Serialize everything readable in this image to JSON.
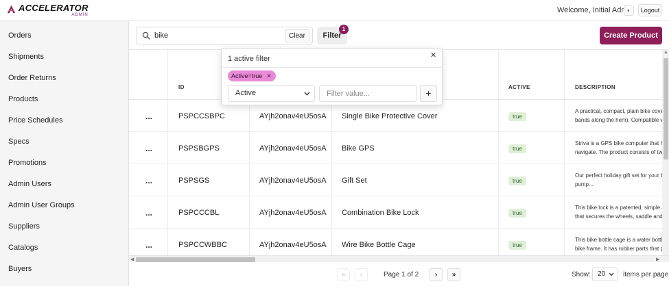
{
  "brand": {
    "name": "ACCELERATOR",
    "sub": "ADMIN",
    "accent": "#8e1f58"
  },
  "header": {
    "welcome": "Welcome, Initial Admin",
    "logout": "Logout",
    "theme_icon": "half-circle-icon"
  },
  "sidebar": {
    "items": [
      {
        "label": "Orders"
      },
      {
        "label": "Shipments"
      },
      {
        "label": "Order Returns"
      },
      {
        "label": "Products"
      },
      {
        "label": "Price Schedules"
      },
      {
        "label": "Specs"
      },
      {
        "label": "Promotions"
      },
      {
        "label": "Admin Users"
      },
      {
        "label": "Admin User Groups"
      },
      {
        "label": "Suppliers"
      },
      {
        "label": "Catalogs"
      },
      {
        "label": "Buyers"
      }
    ]
  },
  "toolbar": {
    "search_value": "bike",
    "clear_label": "Clear",
    "filter_label": "Filter",
    "filter_count": "1",
    "create_label": "Create Product"
  },
  "table": {
    "columns": [
      "ID",
      "ACTIVE",
      "DESCRIPTION"
    ],
    "rows": [
      {
        "actions": "...",
        "id": "PSPCCSBPC",
        "owner": "AYjh2onav4eU5osA",
        "name": "Single Bike Protective Cover",
        "active": "true",
        "desc1": "A practical, compact, plain bike cover",
        "desc2": "bands along the hem). Compatible w"
      },
      {
        "actions": "...",
        "id": "PSPSBGPS",
        "owner": "AYjh2onav4eU5osA",
        "name": "Bike GPS",
        "active": "true",
        "desc1": "Striva is a GPS bike computer that he",
        "desc2": "navigate. The product consists of two"
      },
      {
        "actions": "...",
        "id": "PSPSGS",
        "owner": "AYjh2onav4eU5osA",
        "name": "Gift Set",
        "active": "true",
        "desc1": "Our perfect holiday gift set for your b",
        "desc2": "pump..."
      },
      {
        "actions": "...",
        "id": "PSPCCCBL",
        "owner": "AYjh2onav4eU5osA",
        "name": "Combination Bike Lock",
        "active": "true",
        "desc1": "This bike lock is a patented, simple ar",
        "desc2": "that secures the wheels, saddle and c"
      },
      {
        "actions": "...",
        "id": "PSPCCWBBC",
        "owner": "AYjh2onav4eU5osA",
        "name": "Wire Bike Bottle Cage",
        "active": "true",
        "desc1": "This bike bottle cage is a water bottle",
        "desc2": "bike frame. It has rubber parts that p"
      }
    ]
  },
  "pagination": {
    "first": "«",
    "prev": "‹",
    "next": "›",
    "last": "»",
    "page_text": "Page 1 of 2",
    "show_label": "Show:",
    "page_size": "20",
    "per_page_label": "items per page"
  },
  "filter_popover": {
    "title": "1 active filter",
    "chip": "Active=true",
    "chip_remove": "✕",
    "close": "✕",
    "field": "Active",
    "value_placeholder": "Filter value...",
    "add": "+"
  }
}
